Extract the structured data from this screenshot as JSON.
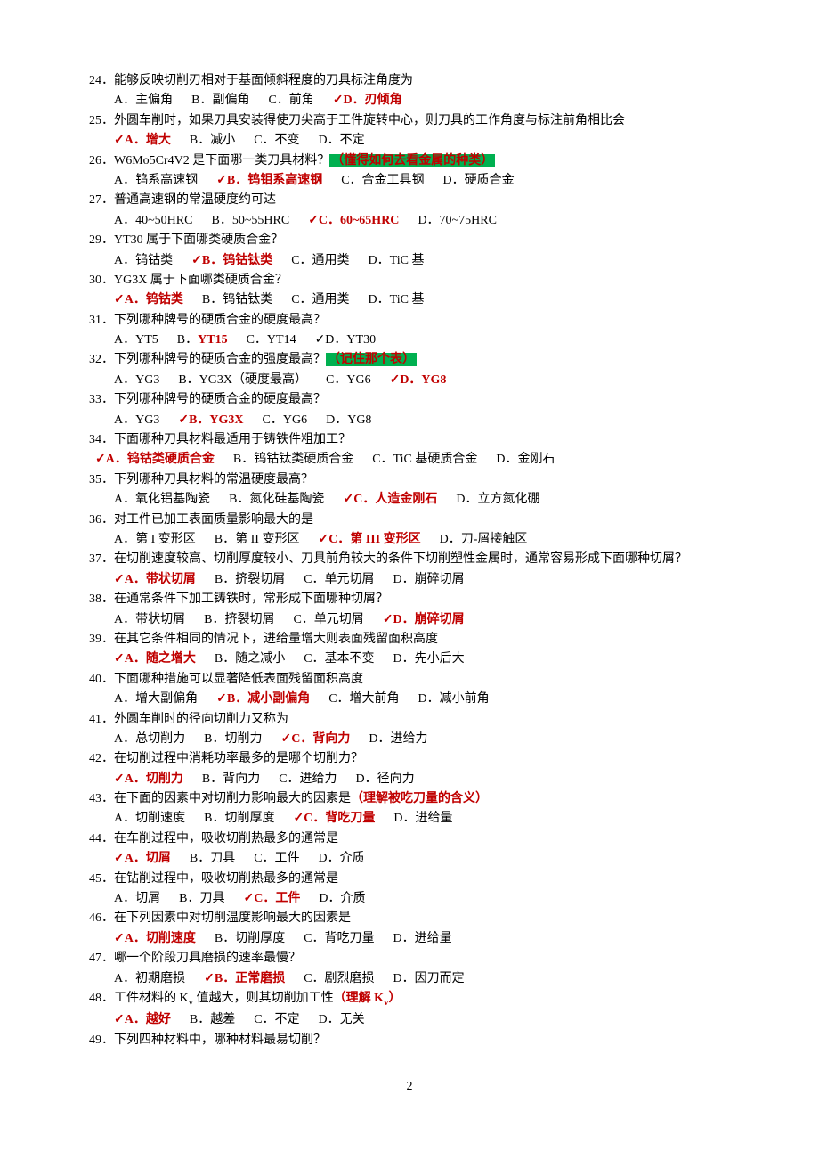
{
  "page_number": "2",
  "questions": [
    {
      "num": "24",
      "text": "．能够反映切削刃相对于基面倾斜程度的刀具标注角度为",
      "options": [
        {
          "label": "A．主偏角",
          "correct": false
        },
        {
          "label": "B．副偏角",
          "correct": false
        },
        {
          "label": "C．前角",
          "correct": false
        },
        {
          "label": "D．刃倾角",
          "correct": true
        }
      ]
    },
    {
      "num": "25",
      "text": "．外圆车削时，如果刀具安装得使刀尖高于工件旋转中心，则刀具的工作角度与标注前角相比会",
      "options": [
        {
          "label": "A．增大",
          "correct": true
        },
        {
          "label": "B．减小",
          "correct": false
        },
        {
          "label": "C．不变",
          "correct": false
        },
        {
          "label": "D．不定",
          "correct": false
        }
      ]
    },
    {
      "num": "26",
      "text": "．W6Mo5Cr4V2 是下面哪一类刀具材料？",
      "note_green": "（懂得如何去看金属的种类）",
      "options": [
        {
          "label": "A．钨系高速钢",
          "correct": false
        },
        {
          "label": "B．钨钼系高速钢",
          "correct": true
        },
        {
          "label": "C．合金工具钢",
          "correct": false
        },
        {
          "label": "D．硬质合金",
          "correct": false
        }
      ]
    },
    {
      "num": "27",
      "text": "．普通高速钢的常温硬度约可达",
      "options": [
        {
          "label": "A．40~50HRC",
          "correct": false
        },
        {
          "label": "B．50~55HRC",
          "correct": false
        },
        {
          "label": "C．60~65HRC",
          "correct": true
        },
        {
          "label": "D．70~75HRC",
          "correct": false
        }
      ]
    },
    {
      "num": "29",
      "text": "．YT30 属于下面哪类硬质合金？",
      "options": [
        {
          "label": "A．钨钴类",
          "correct": false
        },
        {
          "label": "B．钨钴钛类",
          "correct": true
        },
        {
          "label": "C．通用类",
          "correct": false
        },
        {
          "label": "D．TiC 基",
          "correct": false
        }
      ]
    },
    {
      "num": "30",
      "text": "．YG3X 属于下面哪类硬质合金？",
      "options": [
        {
          "label": "A．钨钴类",
          "correct": true
        },
        {
          "label": "B．钨钴钛类",
          "correct": false
        },
        {
          "label": "C．通用类",
          "correct": false
        },
        {
          "label": "D．TiC 基",
          "correct": false
        }
      ]
    },
    {
      "num": "31",
      "text": "．下列哪种牌号的硬质合金的硬度最高？",
      "options": [
        {
          "label_prefix": "A．YT5",
          "correct": false
        },
        {
          "label_prefix": "B．",
          "label_red": "YT15",
          "correct": false
        },
        {
          "label_prefix": "C．YT14",
          "correct": false
        },
        {
          "label_prefix": "✓D．YT30",
          "correct": false,
          "plain_check": true
        }
      ]
    },
    {
      "num": "32",
      "text": "．下列哪种牌号的硬质合金的强度最高？",
      "note_green": "（记住那个表）",
      "options": [
        {
          "label": "A．YG3",
          "correct": false
        },
        {
          "label": "B．YG3X（硬度最高）",
          "correct": false
        },
        {
          "label": "C．YG6",
          "correct": false
        },
        {
          "label": "D．YG8",
          "correct": true
        }
      ]
    },
    {
      "num": "33",
      "text": "．下列哪种牌号的硬质合金的硬度最高？",
      "options": [
        {
          "label": "A．YG3",
          "correct": false
        },
        {
          "label": "B．YG3X",
          "correct": true
        },
        {
          "label": "C．YG6",
          "correct": false
        },
        {
          "label": "D．YG8",
          "correct": false
        }
      ]
    },
    {
      "num": "34",
      "text": "．下面哪种刀具材料最适用于铸铁件粗加工？",
      "options_noindent": true,
      "options": [
        {
          "label": "A．钨钴类硬质合金",
          "correct": true
        },
        {
          "label": "B．钨钴钛类硬质合金",
          "correct": false
        },
        {
          "label": "C．TiC 基硬质合金",
          "correct": false
        },
        {
          "label": "D．金刚石",
          "correct": false
        }
      ]
    },
    {
      "num": "35",
      "text": "．下列哪种刀具材料的常温硬度最高？",
      "options": [
        {
          "label": "A．氧化铝基陶瓷",
          "correct": false
        },
        {
          "label": "B．氮化硅基陶瓷",
          "correct": false
        },
        {
          "label": "C．人造金刚石",
          "correct": true
        },
        {
          "label": "D．立方氮化硼",
          "correct": false
        }
      ]
    },
    {
      "num": "36",
      "text": "．对工件已加工表面质量影响最大的是",
      "options": [
        {
          "label": "A．第 I 变形区",
          "correct": false
        },
        {
          "label": "B．第 II 变形区",
          "correct": false
        },
        {
          "label": "C．第 III 变形区",
          "correct": true
        },
        {
          "label": "D．刀-屑接触区",
          "correct": false
        }
      ]
    },
    {
      "num": "37",
      "text": "．在切削速度较高、切削厚度较小、刀具前角较大的条件下切削塑性金属时，通常容易形成下面哪种切屑？",
      "options": [
        {
          "label": "A．带状切屑",
          "correct": true
        },
        {
          "label": "B．挤裂切屑",
          "correct": false
        },
        {
          "label": "C．单元切屑",
          "correct": false
        },
        {
          "label": "D．崩碎切屑",
          "correct": false
        }
      ]
    },
    {
      "num": "38",
      "text": "．在通常条件下加工铸铁时，常形成下面哪种切屑？",
      "options": [
        {
          "label": "A．带状切屑",
          "correct": false
        },
        {
          "label": "B．挤裂切屑",
          "correct": false
        },
        {
          "label": "C．单元切屑",
          "correct": false
        },
        {
          "label": "D．崩碎切屑",
          "correct": true
        }
      ]
    },
    {
      "num": "39",
      "text": "．在其它条件相同的情况下，进给量增大则表面残留面积高度",
      "options": [
        {
          "label": "A．随之增大",
          "correct": true
        },
        {
          "label": "B．随之减小",
          "correct": false
        },
        {
          "label": "C．基本不变",
          "correct": false
        },
        {
          "label": "D．先小后大",
          "correct": false
        }
      ]
    },
    {
      "num": "40",
      "text": "．下面哪种措施可以显著降低表面残留面积高度",
      "options": [
        {
          "label": "A．增大副偏角",
          "correct": false
        },
        {
          "label": "B．减小副偏角",
          "correct": true
        },
        {
          "label": "C．增大前角",
          "correct": false
        },
        {
          "label": "D．减小前角",
          "correct": false
        }
      ]
    },
    {
      "num": "41",
      "text": "．外圆车削时的径向切削力又称为",
      "options": [
        {
          "label": "A．总切削力",
          "correct": false
        },
        {
          "label": "B．切削力",
          "correct": false
        },
        {
          "label": "C．背向力",
          "correct": true
        },
        {
          "label": "D．进给力",
          "correct": false
        }
      ]
    },
    {
      "num": "42",
      "text": "．在切削过程中消耗功率最多的是哪个切削力？",
      "options": [
        {
          "label": "A．切削力",
          "correct": true
        },
        {
          "label": "B．背向力",
          "correct": false
        },
        {
          "label": "C．进给力",
          "correct": false
        },
        {
          "label": "D．径向力",
          "correct": false
        }
      ]
    },
    {
      "num": "43",
      "text": "．在下面的因素中对切削力影响最大的因素是",
      "note_red": "（理解被吃刀量的含义）",
      "options": [
        {
          "label": "A．切削速度",
          "correct": false
        },
        {
          "label": "B．切削厚度",
          "correct": false
        },
        {
          "label": "C．背吃刀量",
          "correct": true
        },
        {
          "label": "D．进给量",
          "correct": false
        }
      ]
    },
    {
      "num": "44",
      "text": "．在车削过程中，吸收切削热最多的通常是",
      "options": [
        {
          "label": "A．切屑",
          "correct": true
        },
        {
          "label": "B．刀具",
          "correct": false
        },
        {
          "label": "C．工件",
          "correct": false
        },
        {
          "label": "D．介质",
          "correct": false
        }
      ]
    },
    {
      "num": "45",
      "text": "．在钻削过程中，吸收切削热最多的通常是",
      "options": [
        {
          "label": "A．切屑",
          "correct": false
        },
        {
          "label": "B．刀具",
          "correct": false
        },
        {
          "label": "C．工件",
          "correct": true
        },
        {
          "label": "D．介质",
          "correct": false
        }
      ]
    },
    {
      "num": "46",
      "text": "．在下列因素中对切削温度影响最大的因素是",
      "options": [
        {
          "label": "A．切削速度",
          "correct": true
        },
        {
          "label": "B．切削厚度",
          "correct": false
        },
        {
          "label": "C．背吃刀量",
          "correct": false
        },
        {
          "label": "D．进给量",
          "correct": false
        }
      ]
    },
    {
      "num": "47",
      "text": "．哪一个阶段刀具磨损的速率最慢？",
      "options": [
        {
          "label": "A．初期磨损",
          "correct": false
        },
        {
          "label": "B．正常磨损",
          "correct": true
        },
        {
          "label": "C．剧烈磨损",
          "correct": false
        },
        {
          "label": "D．因刀而定",
          "correct": false
        }
      ]
    },
    {
      "num": "48",
      "text_prefix": "．工件材料的 K",
      "text_sub": "v",
      "text_suffix": " 值越大，则其切削加工性",
      "note_red_prefix": "（理解 K",
      "note_red_sub": "v",
      "note_red_suffix": "）",
      "options": [
        {
          "label": "A．越好",
          "correct": true
        },
        {
          "label": "B．越差",
          "correct": false
        },
        {
          "label": "C．不定",
          "correct": false
        },
        {
          "label": "D．无关",
          "correct": false
        }
      ]
    },
    {
      "num": "49",
      "text": "．下列四种材料中，哪种材料最易切削？",
      "options": []
    }
  ]
}
